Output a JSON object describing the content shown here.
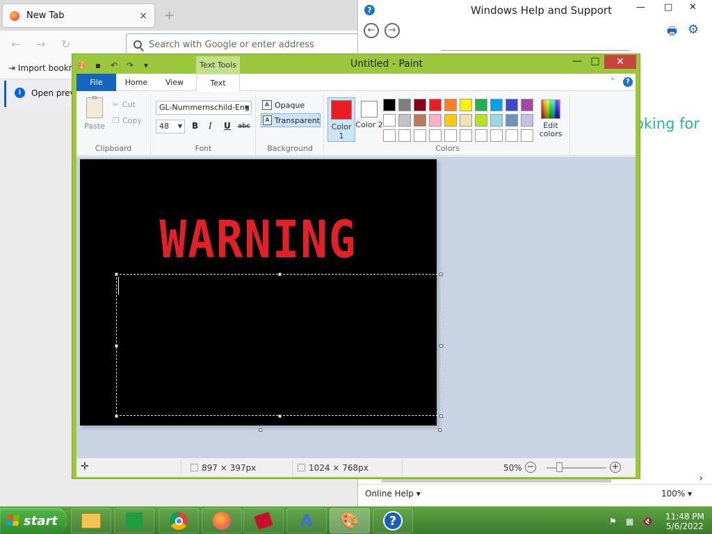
{
  "firefox": {
    "tab_title": "New Tab",
    "tab_close": "×",
    "new_tab": "+",
    "back": "←",
    "forward": "→",
    "reload": "↻",
    "url_placeholder": "Search with Google or enter address",
    "bookmark_import": "Import bookm",
    "info_text": "Open previ"
  },
  "help": {
    "title": "Windows Help and Support",
    "minimize": "—",
    "maximize": "□",
    "close": "✕",
    "back": "←",
    "forward": "→",
    "looking_text": "oking for",
    "online_help": "Online Help ▾",
    "zoom": "100% ▾"
  },
  "paint": {
    "title": "Untitled - Paint",
    "context_tab": "Text Tools",
    "minimize": "—",
    "maximize": "□",
    "close": "✕",
    "tabs": {
      "file": "File",
      "home": "Home",
      "view": "View",
      "text": "Text"
    },
    "clipboard": {
      "paste": "Paste",
      "cut": "Cut",
      "copy": "Copy",
      "label": "Clipboard"
    },
    "font": {
      "name": "GL-Nummernschild-Eng",
      "size": "48",
      "bold": "B",
      "italic": "I",
      "underline": "U",
      "strike": "abc",
      "label": "Font"
    },
    "background": {
      "opaque": "Opaque",
      "transparent": "Transparent",
      "label": "Background"
    },
    "colors": {
      "color1_label": "Color 1",
      "color2_label": "Color 2",
      "color1": "#ed1c24",
      "color2": "#ffffff",
      "edit_label": "Edit colors",
      "label": "Colors",
      "palette": [
        "#000000",
        "#7f7f7f",
        "#880015",
        "#ed1c24",
        "#ff7f27",
        "#fff200",
        "#22b14c",
        "#00a2e8",
        "#3f48cc",
        "#a349a4",
        "#ffffff",
        "#c3c3c3",
        "#b97a57",
        "#ffaec9",
        "#ffc90e",
        "#efe4b0",
        "#b5e61d",
        "#99d9ea",
        "#7092be",
        "#c8bfe7",
        "#ffffff",
        "#ffffff",
        "#ffffff",
        "#ffffff",
        "#ffffff",
        "#ffffff",
        "#ffffff",
        "#ffffff",
        "#ffffff",
        "#ffffff"
      ]
    },
    "canvas_text": "WARNING",
    "status": {
      "selection_size": "897 × 397px",
      "image_size": "1024 × 768px",
      "zoom": "50%",
      "zoom_out": "−",
      "zoom_in": "+"
    }
  },
  "taskbar": {
    "start_label": "start",
    "help_glyph": "?",
    "time": "11:48 PM",
    "date": "5/6/2022"
  }
}
